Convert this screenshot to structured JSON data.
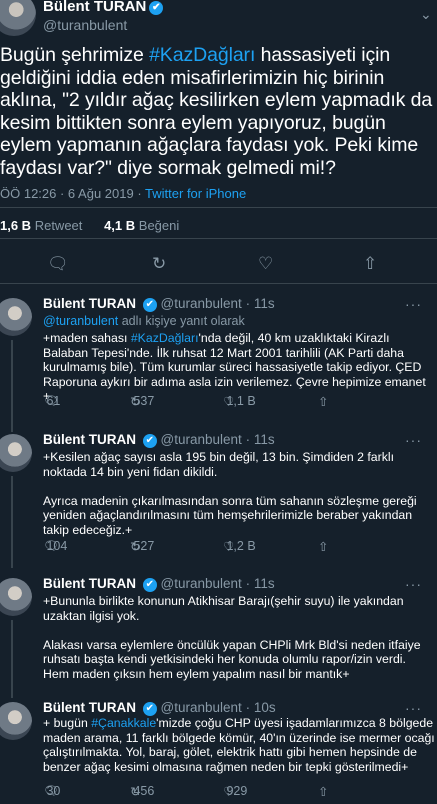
{
  "main": {
    "name": "Bülent TURAN",
    "verified_icon": "✔",
    "handle": "@turanbulent",
    "text_a": "Bugün şehrimize ",
    "hashtag": "#KazDağları",
    "text_b": " hassasiyeti için geldiğini iddia eden misafirlerimizin hiç birinin aklına, \"2 yıldır ağaç kesilirken eylem yapmadık da kesim bittikten sonra eylem yapıyoruz, bugün eylem yapmanın ağaçlara faydası yok. Peki kime faydası var?\" diye sormak gelmedi mi!?",
    "time": "ÖÖ 12:26 · 6 Ağu 2019",
    "source": "Twitter for iPhone",
    "retweets_count": "1,6 B",
    "retweets_label": "Retweet",
    "likes_count": "4,1 B",
    "likes_label": "Beğeni"
  },
  "replies": [
    {
      "name": "Bülent TURAN",
      "handle": "@turanbulent",
      "age": "11s",
      "replying_user": "@turanbulent",
      "replying_suffix": "adlı kişiye yanıt olarak",
      "text_a": "+maden sahası ",
      "hashtag": "#KazDağları",
      "text_b": "'nda değil, 40 km uzaklıktaki Kirazlı Balaban Tepesi'nde. İlk ruhsat 12 Mart 2001 tarihlili (AK Parti daha kurulmamış bile). Tüm kurumlar süreci hassasiyetle takip ediyor. ÇED Raporuna aykırı bir adıma asla izin verilemez. Çevre hepimize emanet +",
      "replies": "61",
      "retweets": "537",
      "likes": "1,1 B"
    },
    {
      "name": "Bülent TURAN",
      "handle": "@turanbulent",
      "age": "11s",
      "text": "+Kesilen ağaç sayısı asla 195 bin değil, 13 bin.  Şimdiden 2 farklı noktada 14 bin yeni fidan dikildi.\n\nAyrıca madenin çıkarılmasından sonra tüm sahanın sözleşme gereği yeniden ağaçlandırılmasını tüm hemşehrilerimizle beraber yakından takip edeceğiz.+",
      "replies": "104",
      "retweets": "527",
      "likes": "1,2 B"
    },
    {
      "name": "Bülent TURAN",
      "handle": "@turanbulent",
      "age": "11s",
      "text": "+Bununla birlikte konunun Atikhisar Barajı(şehir suyu) ile yakından uzaktan ilgisi yok.\n\nAlakası varsa eylemlere öncülük yapan CHPli Mrk Bld'si neden itfaiye ruhsatı başta kendi yetkisindeki her konuda olumlu rapor/izin verdi. Hem maden çıksın hem eylem yapalım nasıl bir mantık+"
    },
    {
      "name": "Bülent TURAN",
      "handle": "@turanbulent",
      "age": "10s",
      "text_a": "+ bugün ",
      "hashtag": "#Çanakkale",
      "text_b": "'mizde çoğu CHP üyesi işadamlarımızca  8 bölgede maden arama, 11 farklı bölgede kömür, 40'ın üzerinde ise mermer ocağı çalıştırılmakta. Yol, baraj, gölet, elektrik hattı gibi hemen hepsinde de benzer ağaç kesimi olmasına rağmen neden bir tepki gösterilmedi+",
      "replies": "30",
      "retweets": "456",
      "likes": "929"
    }
  ],
  "icons": {
    "reply": "reply-bubble-icon",
    "retweet": "retweet-icon",
    "like": "heart-icon",
    "share": "share-icon",
    "more": "more-dots-icon"
  },
  "colors": {
    "background": "#15202b",
    "accent": "#1da1f2",
    "muted": "#8899a6",
    "divider": "#38444d"
  }
}
